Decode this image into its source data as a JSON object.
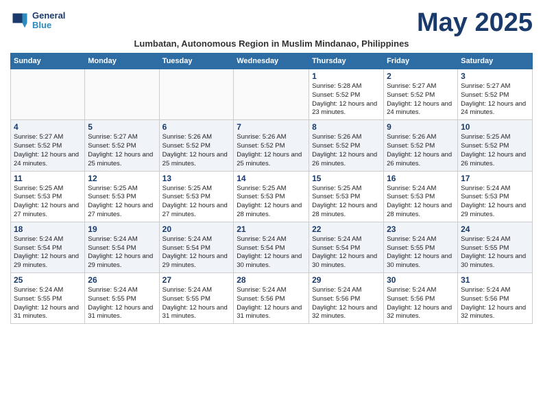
{
  "header": {
    "logo_line1": "General",
    "logo_line2": "Blue",
    "month_title": "May 2025",
    "subtitle": "Lumbatan, Autonomous Region in Muslim Mindanao, Philippines"
  },
  "weekdays": [
    "Sunday",
    "Monday",
    "Tuesday",
    "Wednesday",
    "Thursday",
    "Friday",
    "Saturday"
  ],
  "rows": [
    [
      {
        "day": "",
        "detail": ""
      },
      {
        "day": "",
        "detail": ""
      },
      {
        "day": "",
        "detail": ""
      },
      {
        "day": "",
        "detail": ""
      },
      {
        "day": "1",
        "detail": "Sunrise: 5:28 AM\nSunset: 5:52 PM\nDaylight: 12 hours and 23 minutes."
      },
      {
        "day": "2",
        "detail": "Sunrise: 5:27 AM\nSunset: 5:52 PM\nDaylight: 12 hours and 24 minutes."
      },
      {
        "day": "3",
        "detail": "Sunrise: 5:27 AM\nSunset: 5:52 PM\nDaylight: 12 hours and 24 minutes."
      }
    ],
    [
      {
        "day": "4",
        "detail": "Sunrise: 5:27 AM\nSunset: 5:52 PM\nDaylight: 12 hours and 24 minutes."
      },
      {
        "day": "5",
        "detail": "Sunrise: 5:27 AM\nSunset: 5:52 PM\nDaylight: 12 hours and 25 minutes."
      },
      {
        "day": "6",
        "detail": "Sunrise: 5:26 AM\nSunset: 5:52 PM\nDaylight: 12 hours and 25 minutes."
      },
      {
        "day": "7",
        "detail": "Sunrise: 5:26 AM\nSunset: 5:52 PM\nDaylight: 12 hours and 25 minutes."
      },
      {
        "day": "8",
        "detail": "Sunrise: 5:26 AM\nSunset: 5:52 PM\nDaylight: 12 hours and 26 minutes."
      },
      {
        "day": "9",
        "detail": "Sunrise: 5:26 AM\nSunset: 5:52 PM\nDaylight: 12 hours and 26 minutes."
      },
      {
        "day": "10",
        "detail": "Sunrise: 5:25 AM\nSunset: 5:52 PM\nDaylight: 12 hours and 26 minutes."
      }
    ],
    [
      {
        "day": "11",
        "detail": "Sunrise: 5:25 AM\nSunset: 5:53 PM\nDaylight: 12 hours and 27 minutes."
      },
      {
        "day": "12",
        "detail": "Sunrise: 5:25 AM\nSunset: 5:53 PM\nDaylight: 12 hours and 27 minutes."
      },
      {
        "day": "13",
        "detail": "Sunrise: 5:25 AM\nSunset: 5:53 PM\nDaylight: 12 hours and 27 minutes."
      },
      {
        "day": "14",
        "detail": "Sunrise: 5:25 AM\nSunset: 5:53 PM\nDaylight: 12 hours and 28 minutes."
      },
      {
        "day": "15",
        "detail": "Sunrise: 5:25 AM\nSunset: 5:53 PM\nDaylight: 12 hours and 28 minutes."
      },
      {
        "day": "16",
        "detail": "Sunrise: 5:24 AM\nSunset: 5:53 PM\nDaylight: 12 hours and 28 minutes."
      },
      {
        "day": "17",
        "detail": "Sunrise: 5:24 AM\nSunset: 5:53 PM\nDaylight: 12 hours and 29 minutes."
      }
    ],
    [
      {
        "day": "18",
        "detail": "Sunrise: 5:24 AM\nSunset: 5:54 PM\nDaylight: 12 hours and 29 minutes."
      },
      {
        "day": "19",
        "detail": "Sunrise: 5:24 AM\nSunset: 5:54 PM\nDaylight: 12 hours and 29 minutes."
      },
      {
        "day": "20",
        "detail": "Sunrise: 5:24 AM\nSunset: 5:54 PM\nDaylight: 12 hours and 29 minutes."
      },
      {
        "day": "21",
        "detail": "Sunrise: 5:24 AM\nSunset: 5:54 PM\nDaylight: 12 hours and 30 minutes."
      },
      {
        "day": "22",
        "detail": "Sunrise: 5:24 AM\nSunset: 5:54 PM\nDaylight: 12 hours and 30 minutes."
      },
      {
        "day": "23",
        "detail": "Sunrise: 5:24 AM\nSunset: 5:55 PM\nDaylight: 12 hours and 30 minutes."
      },
      {
        "day": "24",
        "detail": "Sunrise: 5:24 AM\nSunset: 5:55 PM\nDaylight: 12 hours and 30 minutes."
      }
    ],
    [
      {
        "day": "25",
        "detail": "Sunrise: 5:24 AM\nSunset: 5:55 PM\nDaylight: 12 hours and 31 minutes."
      },
      {
        "day": "26",
        "detail": "Sunrise: 5:24 AM\nSunset: 5:55 PM\nDaylight: 12 hours and 31 minutes."
      },
      {
        "day": "27",
        "detail": "Sunrise: 5:24 AM\nSunset: 5:55 PM\nDaylight: 12 hours and 31 minutes."
      },
      {
        "day": "28",
        "detail": "Sunrise: 5:24 AM\nSunset: 5:56 PM\nDaylight: 12 hours and 31 minutes."
      },
      {
        "day": "29",
        "detail": "Sunrise: 5:24 AM\nSunset: 5:56 PM\nDaylight: 12 hours and 32 minutes."
      },
      {
        "day": "30",
        "detail": "Sunrise: 5:24 AM\nSunset: 5:56 PM\nDaylight: 12 hours and 32 minutes."
      },
      {
        "day": "31",
        "detail": "Sunrise: 5:24 AM\nSunset: 5:56 PM\nDaylight: 12 hours and 32 minutes."
      }
    ]
  ]
}
